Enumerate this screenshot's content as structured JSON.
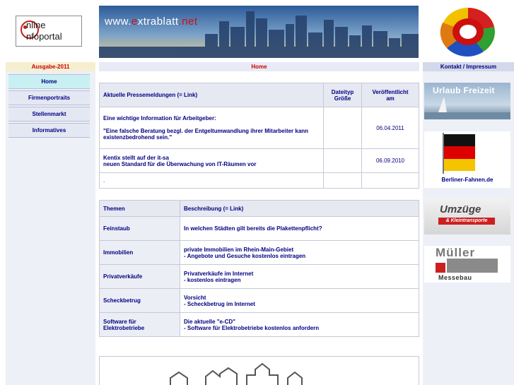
{
  "logo": {
    "line1": "nline",
    "line2": "nfoportal"
  },
  "banner": {
    "url_prefix": "www.",
    "url_e": "e",
    "url_x": "x",
    "url_trablatt": "trablatt",
    "url_net": ".net"
  },
  "nav": {
    "ausgabe": "Ausgabe-2011",
    "home": "Home",
    "kontakt": "Kontakt / Impressum"
  },
  "menu": [
    {
      "label": "Home",
      "active": true
    },
    {
      "label": "Firmenportraits"
    },
    {
      "label": "Stellenmarkt"
    },
    {
      "label": "Informatives"
    }
  ],
  "press": {
    "headers": {
      "title": "Aktuelle Pressemeldungen (= Link)",
      "type_line1": "Dateityp",
      "type_line2": "Größe",
      "pub_line1": "Veröffentlicht",
      "pub_line2": "am"
    },
    "rows": [
      {
        "line1": "Eine wichtige Information für Arbeitgeber:",
        "line2": "\"Eine falsche Beratung bezgl. der Entgeltumwandlung ihrer Mitarbeiter kann existenzbedrohend sein.\"",
        "type": "",
        "date": "06.04.2011"
      },
      {
        "line1": "Kentix stellt auf der it-sa",
        "line2": "neuen Standard für die Überwachung von IT-Räumen vor",
        "type": "",
        "date": "06.09.2010"
      },
      {
        "line1": ".",
        "line2": "",
        "type": "",
        "date": ""
      }
    ]
  },
  "themes": {
    "headers": {
      "topic": "Themen",
      "desc": "Beschreibung (= Link)"
    },
    "rows": [
      {
        "topic": "Feinstaub",
        "desc1": "In welchen Städten gilt bereits die Plakettenpflicht?",
        "desc2": ""
      },
      {
        "topic": "Immobilien",
        "desc1": "private Immobilien im Rhein-Main-Gebiet",
        "desc2": "- Angebote und Gesuche kostenlos eintragen"
      },
      {
        "topic": "Privatverkäufe",
        "desc1": "Privatverkäufe im Internet",
        "desc2": "- kostenlos eintragen"
      },
      {
        "topic": "Scheckbetrug",
        "desc1": "Vorsicht",
        "desc2": "- Scheckbetrug im Internet"
      },
      {
        "topic1": "Software für",
        "topic2": "Elektrobetriebe",
        "desc1": "Die aktuelle \"e-CD\"",
        "desc2": "- Software für Elektrobetriebe kostenlos anfordern"
      }
    ]
  },
  "ads": {
    "urlaub": "Urlaub Freizeit",
    "fahnen": "Berliner-Fahnen.de",
    "umzuege": "Umzüge",
    "umzuege_sub": "& Kleintransporte",
    "mueller": "Müller",
    "mueller_sub": "Messebau"
  },
  "colors": {
    "nav_accent": "#cc0000",
    "link_blue": "#000080",
    "menu_active": "#c8f0f2"
  }
}
